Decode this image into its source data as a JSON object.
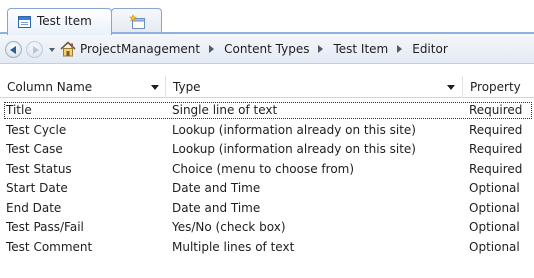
{
  "tabs": [
    {
      "label": "Test Item",
      "active": true,
      "icon": "list-form-icon"
    },
    {
      "label": "",
      "active": false,
      "icon": "new-tab-icon"
    }
  ],
  "breadcrumb": {
    "home_icon": "site-home-icon",
    "items": [
      "ProjectManagement",
      "Content Types",
      "Test Item",
      "Editor"
    ]
  },
  "grid": {
    "headers": {
      "column_name": "Column Name",
      "type": "Type",
      "property": "Property"
    },
    "rows": [
      {
        "name": "Title",
        "type": "Single line of text",
        "property": "Required",
        "selected": true
      },
      {
        "name": "Test Cycle",
        "type": "Lookup (information already on this site)",
        "property": "Required"
      },
      {
        "name": "Test Case",
        "type": "Lookup (information already on this site)",
        "property": "Required"
      },
      {
        "name": "Test Status",
        "type": "Choice (menu to choose from)",
        "property": "Required"
      },
      {
        "name": "Start Date",
        "type": "Date and Time",
        "property": "Optional"
      },
      {
        "name": "End Date",
        "type": "Date and Time",
        "property": "Optional"
      },
      {
        "name": "Test Pass/Fail",
        "type": "Yes/No (check box)",
        "property": "Optional"
      },
      {
        "name": "Test Comment",
        "type": "Multiple lines of text",
        "property": "Optional"
      }
    ]
  },
  "colors": {
    "tab_border": "#8aa6cf",
    "tab_baseline": "#8db2e3",
    "navbar_bg": "#e3eaf3",
    "text": "#1e1e1e"
  }
}
